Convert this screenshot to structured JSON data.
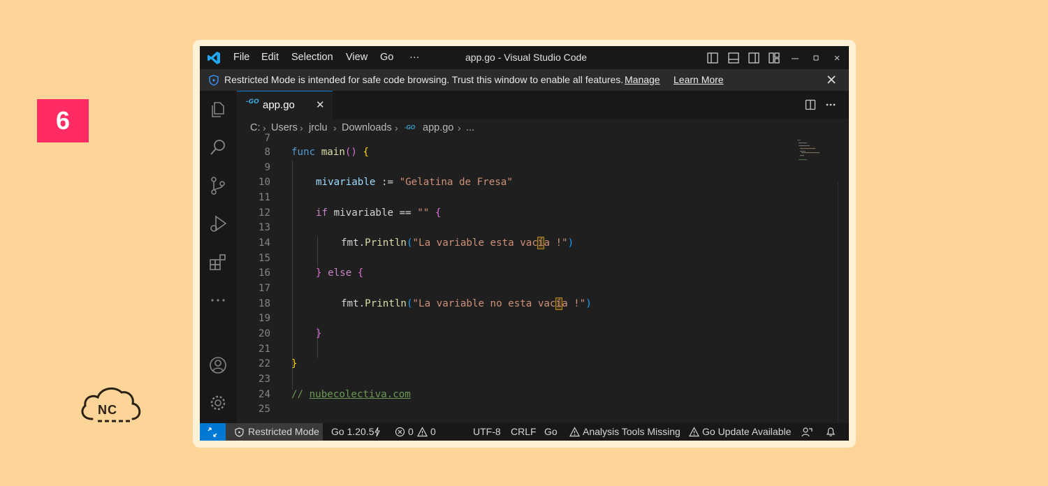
{
  "step_badge": "6",
  "logo": {
    "text": "NC"
  },
  "titlebar": {
    "menu": [
      "File",
      "Edit",
      "Selection",
      "View",
      "Go",
      "···"
    ],
    "title": "app.go - Visual Studio Code"
  },
  "banner": {
    "message": "Restricted Mode is intended for safe code browsing. Trust this window to enable all features.",
    "manage": "Manage",
    "learn_more": "Learn More"
  },
  "tab": {
    "label": "app.go",
    "close": "✕"
  },
  "breadcrumb": [
    "C:",
    "Users",
    "jrclu",
    "Downloads",
    "app.go",
    "..."
  ],
  "editor": {
    "line_numbers": [
      "7",
      "8",
      "9",
      "10",
      "11",
      "12",
      "13",
      "14",
      "15",
      "16",
      "17",
      "18",
      "19",
      "20",
      "21",
      "22",
      "23",
      "24",
      "25"
    ],
    "code": {
      "l8_kw": "func",
      "l8_fn": "main",
      "l8_br": "()",
      "l8_open": "{",
      "l10_var": "mivariable",
      "l10_op": " := ",
      "l10_str": "\"Gelatina de Fresa\"",
      "l12_kw": "if",
      "l12_rest": " mivariable == ",
      "l12_str": "\"\"",
      "l12_open": "{",
      "l14_pkg": "fmt.",
      "l14_fn": "Println",
      "l14_open": "(",
      "l14_str_a": "\"La variable esta vac",
      "l14_hl": "í",
      "l14_str_b": "a !\"",
      "l14_close": ")",
      "l16_close": "}",
      "l16_kw": " else ",
      "l16_open": "{",
      "l18_pkg": "fmt.",
      "l18_fn": "Println",
      "l18_open": "(",
      "l18_str_a": "\"La variable no esta vac",
      "l18_hl": "í",
      "l18_str_b": "a !\"",
      "l18_close": ")",
      "l20_close": "}",
      "l22_close": "}",
      "l24_slash": "// ",
      "l24_link": "nubecolectiva.com"
    }
  },
  "status": {
    "restricted": "Restricted Mode",
    "go_version": "Go 1.20.5",
    "errors": "0",
    "warnings": "0",
    "encoding": "UTF-8",
    "eol": "CRLF",
    "language": "Go",
    "analysis": "Analysis Tools Missing",
    "update": "Go Update Available"
  },
  "colors": {
    "background": "#fed598",
    "badge": "#ff2b63",
    "accent": "#0078d4",
    "editor_bg": "#1f1f1f"
  }
}
